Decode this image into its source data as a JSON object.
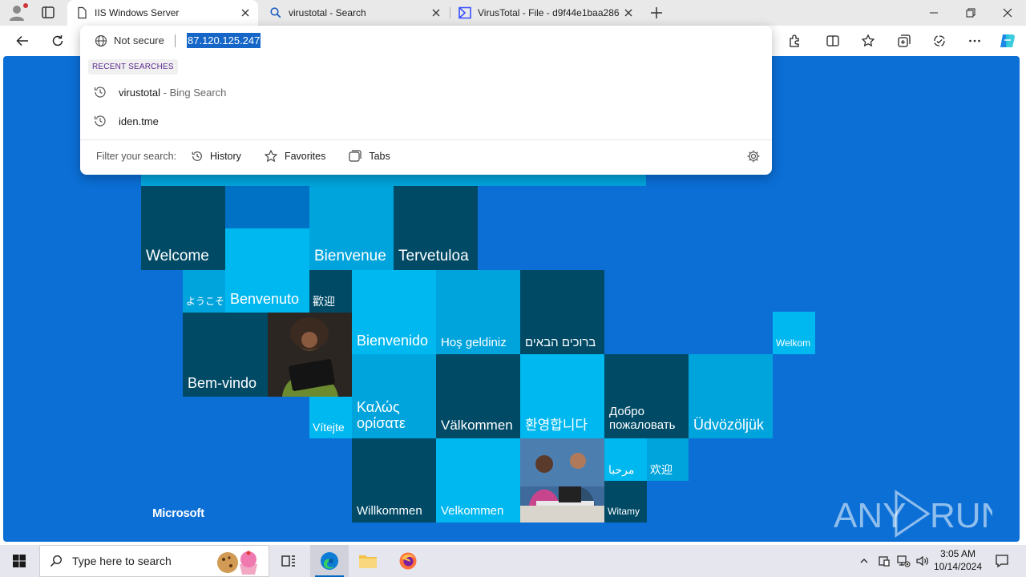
{
  "browser": {
    "tabs": [
      {
        "label": "IIS Windows Server",
        "active": true,
        "favicon": "page-icon"
      },
      {
        "label": "virustotal - Search",
        "active": false,
        "favicon": "search-icon"
      },
      {
        "label": "VirusTotal - File - d9f44e1baa286",
        "active": false,
        "favicon": "virustotal-icon"
      }
    ],
    "window_controls": [
      "minimize",
      "restore",
      "close"
    ]
  },
  "omnibox": {
    "security_label": "Not secure",
    "url": "87.120.125.247",
    "recent_label": "RECENT SEARCHES",
    "suggestions": [
      {
        "text": "virustotal",
        "sub": " - Bing Search"
      },
      {
        "text": "iden.tme",
        "sub": ""
      }
    ],
    "filter_label": "Filter your search:",
    "filters": [
      {
        "label": "History",
        "icon": "history-icon"
      },
      {
        "label": "Favorites",
        "icon": "star-icon"
      },
      {
        "label": "Tabs",
        "icon": "tabs-icon"
      }
    ]
  },
  "iis_page": {
    "greetings": {
      "welcome": "Welcome",
      "bienvenue": "Bienvenue",
      "tervetuloa": "Tervetuloa",
      "youkoso": "ようこそ",
      "benvenuto": "Benvenuto",
      "huanying_trad": "歡迎",
      "bienvenido": "Bienvenido",
      "hos_geldiniz": "Hoş geldiniz",
      "hebrew": "ברוכים הבאים",
      "welkom": "Welkom",
      "bem_vindo": "Bem-vindo",
      "vitejte": "Vítejte",
      "kalos_line1": "Καλώς",
      "kalos_line2": "ορίσατε",
      "valkommen": "Välkommen",
      "korean": "환영합니다",
      "dobro_line1": "Добро",
      "dobro_line2": "пожаловать",
      "udvozoljuk": "Üdvözöljük",
      "willkommen": "Willkommen",
      "velkommen": "Velkommen",
      "marhaba": "مرحبا",
      "huanying_simpl": "欢迎",
      "witamy": "Witamy"
    },
    "brand": "Microsoft",
    "watermark": "ANY RUN"
  },
  "taskbar": {
    "search_placeholder": "Type here to search",
    "time": "3:05 AM",
    "date": "10/14/2024"
  },
  "colors": {
    "page_blue": "#0b6fd6",
    "tile_dark": "#004a66",
    "tile_mid": "#00a4dc",
    "tile_light": "#00b8f0",
    "selection": "#1566c7"
  }
}
